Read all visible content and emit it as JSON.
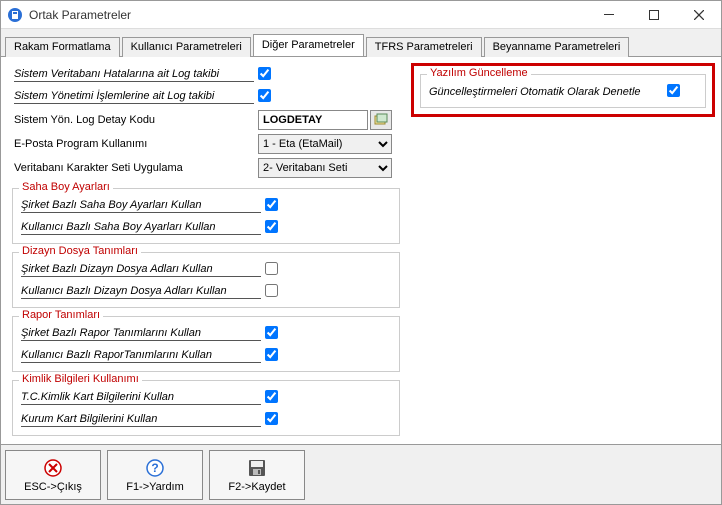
{
  "window": {
    "title": "Ortak Parametreler"
  },
  "tabs": {
    "t0": "Rakam Formatlama",
    "t1": "Kullanıcı Parametreleri",
    "t2": "Diğer Parametreler",
    "t3": "TFRS Parametreleri",
    "t4": "Beyanname Parametreleri",
    "active_index": 2
  },
  "left": {
    "row_sys_db_log": "Sistem Veritabanı Hatalarına ait Log takibi",
    "row_sys_db_log_checked": true,
    "row_sys_mgmt_log": "Sistem Yönetimi İşlemlerine ait Log takibi",
    "row_sys_mgmt_log_checked": true,
    "row_log_code_label": "Sistem Yön. Log Detay Kodu",
    "row_log_code_value": "LOGDETAY",
    "row_email_label": "E-Posta Program Kullanımı",
    "row_email_value": "1 - Eta (EtaMail)",
    "row_charset_label": "Veritabanı Karakter Seti Uygulama",
    "row_charset_value": "2- Veritabanı Seti",
    "grp_saha_title": "Saha Boy Ayarları",
    "grp_saha_r1": "Şirket Bazlı Saha Boy Ayarları Kullan",
    "grp_saha_r1_checked": true,
    "grp_saha_r2": "Kullanıcı Bazlı Saha Boy Ayarları Kullan",
    "grp_saha_r2_checked": true,
    "grp_dizayn_title": "Dizayn Dosya Tanımları",
    "grp_dizayn_r1": "Şirket Bazlı Dizayn Dosya Adları  Kullan",
    "grp_dizayn_r1_checked": false,
    "grp_dizayn_r2": "Kullanıcı Bazlı Dizayn Dosya Adları  Kullan",
    "grp_dizayn_r2_checked": false,
    "grp_rapor_title": "Rapor Tanımları",
    "grp_rapor_r1": "Şirket Bazlı Rapor Tanımlarını Kullan",
    "grp_rapor_r1_checked": true,
    "grp_rapor_r2": "Kullanıcı Bazlı RaporTanımlarını Kullan",
    "grp_rapor_r2_checked": true,
    "grp_kimlik_title": "Kimlik Bilgileri Kullanımı",
    "grp_kimlik_r1": "T.C.Kimlik Kart Bilgilerini Kullan",
    "grp_kimlik_r1_checked": true,
    "grp_kimlik_r2": "Kurum Kart Bilgilerini Kullan",
    "grp_kimlik_r2_checked": true
  },
  "right": {
    "grp_update_title": "Yazılım Güncelleme",
    "row_auto_update": "Güncelleştirmeleri Otomatik Olarak Denetle",
    "row_auto_update_checked": true
  },
  "footer": {
    "btn_exit": "ESC->Çıkış",
    "btn_help": "F1->Yardım",
    "btn_save": "F2->Kaydet"
  }
}
